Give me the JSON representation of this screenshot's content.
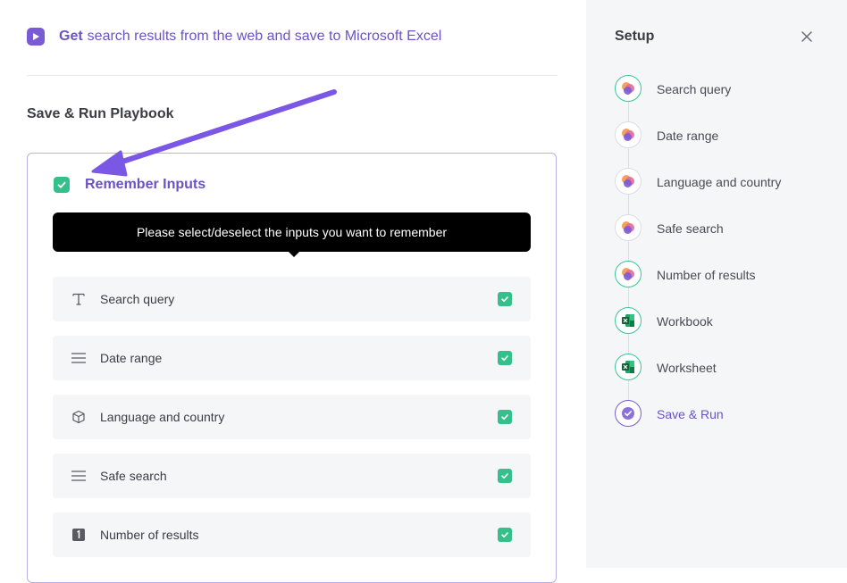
{
  "header": {
    "action": "Get",
    "description": "search results from the web and save to Microsoft Excel",
    "icon": "play-icon"
  },
  "section_title": "Save & Run Playbook",
  "remember": {
    "label": "Remember Inputs",
    "checked": true
  },
  "tooltip": "Please select/deselect the inputs you want to remember",
  "inputs": [
    {
      "label": "Search query",
      "icon": "text-icon",
      "checked": true
    },
    {
      "label": "Date range",
      "icon": "list-icon",
      "checked": true
    },
    {
      "label": "Language and country",
      "icon": "cube-icon",
      "checked": true
    },
    {
      "label": "Safe search",
      "icon": "list-icon",
      "checked": true
    },
    {
      "label": "Number of results",
      "icon": "number-icon",
      "checked": true
    }
  ],
  "setup": {
    "title": "Setup",
    "steps": [
      {
        "label": "Search query",
        "icon": "app-logo-icon",
        "status": "done"
      },
      {
        "label": "Date range",
        "icon": "app-logo-icon",
        "status": "pending"
      },
      {
        "label": "Language and country",
        "icon": "app-logo-icon",
        "status": "pending"
      },
      {
        "label": "Safe search",
        "icon": "app-logo-icon",
        "status": "pending"
      },
      {
        "label": "Number of results",
        "icon": "app-logo-icon",
        "status": "done"
      },
      {
        "label": "Workbook",
        "icon": "excel-icon",
        "status": "done"
      },
      {
        "label": "Worksheet",
        "icon": "excel-icon",
        "status": "done"
      },
      {
        "label": "Save & Run",
        "icon": "check-circle-icon",
        "status": "current"
      }
    ]
  },
  "colors": {
    "accent": "#6a52c9",
    "check": "#35c08b",
    "annotation_arrow": "#7b57e6"
  }
}
